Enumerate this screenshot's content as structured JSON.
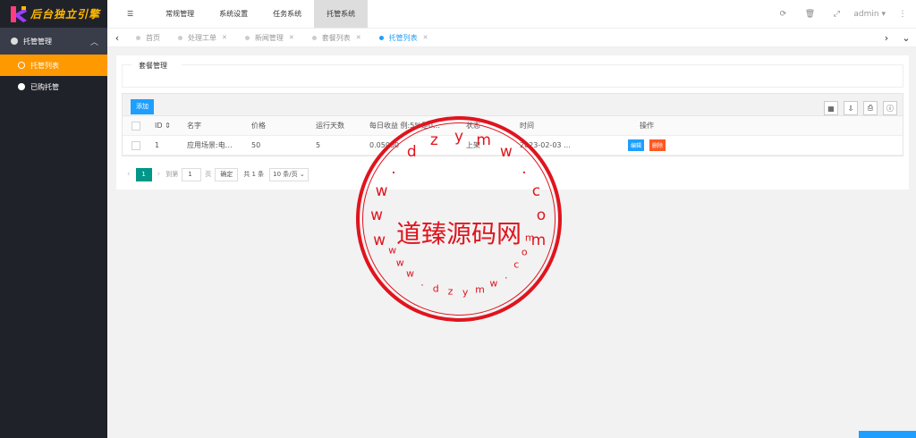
{
  "sidebar": {
    "logo_text": "后台独立引擎",
    "group_label": "托管管理",
    "items": [
      {
        "label": "托管列表",
        "active": true
      },
      {
        "label": "已购托管",
        "active": false
      }
    ]
  },
  "header": {
    "menus": [
      {
        "label": "常规管理"
      },
      {
        "label": "系统设置"
      },
      {
        "label": "任务系统"
      },
      {
        "label": "托管系统"
      }
    ],
    "user": "admin"
  },
  "tabs": [
    {
      "label": "首页",
      "closable": false
    },
    {
      "label": "处理工单",
      "closable": true
    },
    {
      "label": "新闻管理",
      "closable": true
    },
    {
      "label": "套餐列表",
      "closable": true
    },
    {
      "label": "托管列表",
      "closable": true,
      "active": true
    }
  ],
  "card": {
    "title": "套餐管理"
  },
  "toolbar": {
    "add_label": "添加"
  },
  "table": {
    "columns": [
      "ID",
      "名字",
      "价格",
      "运行天数",
      "每日收益 例:5%是0…",
      "状态",
      "时间",
      "操作"
    ],
    "rows": [
      {
        "id": "1",
        "name": "应用场景:电…",
        "price": "50",
        "days": "5",
        "daily": "0.05000",
        "status": "上架",
        "time": "2023-02-03 …",
        "edit": "编辑",
        "del": "删除"
      }
    ]
  },
  "pager": {
    "page": "1",
    "goto_label": "到第",
    "goto_value": "1",
    "page_unit": "页",
    "confirm": "确定",
    "total": "共 1 条",
    "per_page": "10 条/页"
  },
  "watermark": {
    "center": "道臻源码网",
    "ring_chars": [
      "w",
      "w",
      "w",
      ".",
      "d",
      "z",
      "y",
      "m",
      "w",
      ".",
      "c",
      "o",
      "m"
    ]
  }
}
